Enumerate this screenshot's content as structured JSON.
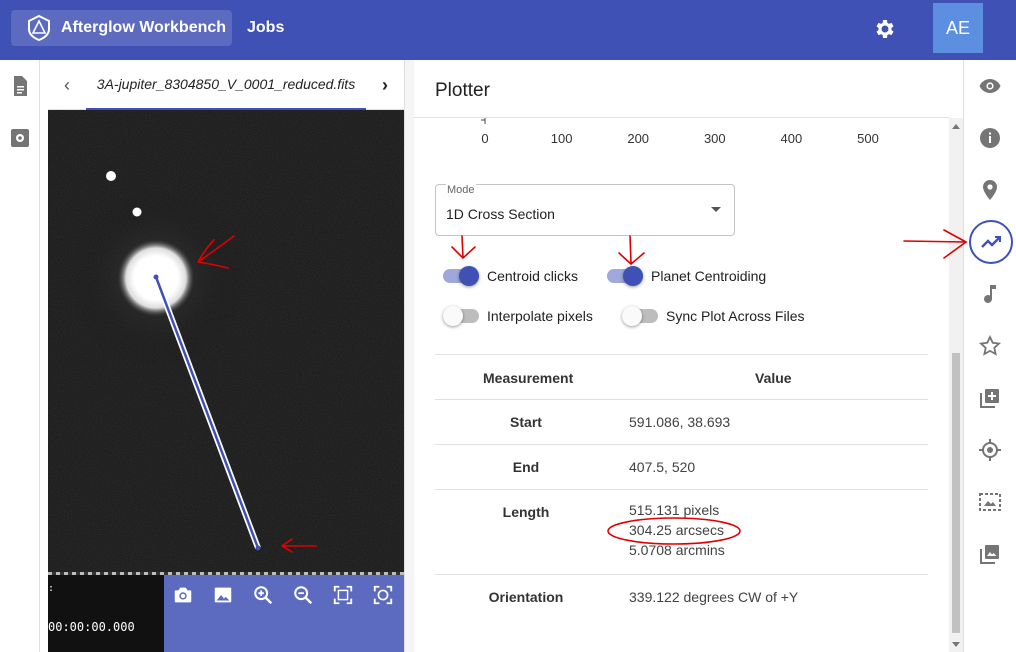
{
  "app": {
    "brand": "Afterglow Workbench",
    "nav_jobs": "Jobs",
    "avatar_initials": "AE"
  },
  "file_tab": {
    "name": "3A-jupiter_8304850_V_0001_reduced.fits"
  },
  "viewer": {
    "timecode": "00:00:00.000",
    "tools": [
      "camera-icon",
      "image-icon",
      "zoom-in-icon",
      "zoom-out-icon",
      "fit-screen-icon",
      "zoom-reset-icon"
    ]
  },
  "plotter": {
    "title": "Plotter",
    "axis_ticks": [
      "0",
      "100",
      "200",
      "300",
      "400",
      "500"
    ],
    "mode": {
      "label": "Mode",
      "value": "1D Cross Section"
    },
    "toggles": {
      "centroid_clicks": {
        "label": "Centroid clicks",
        "on": true
      },
      "planet_centroiding": {
        "label": "Planet Centroiding",
        "on": true
      },
      "interpolate_pixels": {
        "label": "Interpolate pixels",
        "on": false
      },
      "sync_plot": {
        "label": "Sync Plot Across Files",
        "on": false
      }
    },
    "table": {
      "col_measurement": "Measurement",
      "col_value": "Value",
      "start": {
        "label": "Start",
        "value": "591.086, 38.693"
      },
      "end": {
        "label": "End",
        "value": "407.5, 520"
      },
      "length": {
        "label": "Length",
        "pixels": "515.131 pixels",
        "arcsecs": "304.25 arcsecs",
        "arcmins": "5.0708 arcmins"
      },
      "orientation": {
        "label": "Orientation",
        "value": "339.122 degrees CW of +Y"
      }
    }
  },
  "right_sidebar": {
    "icons": [
      "eye-icon",
      "info-icon",
      "location-pin-icon",
      "plotter-icon",
      "music-note-icon",
      "star-icon",
      "add-box-icon",
      "target-icon",
      "photo-roi-icon",
      "photo-library-icon"
    ],
    "active": "plotter-icon"
  },
  "colors": {
    "primary": "#3f51b5",
    "annotation_red": "#e00000"
  }
}
